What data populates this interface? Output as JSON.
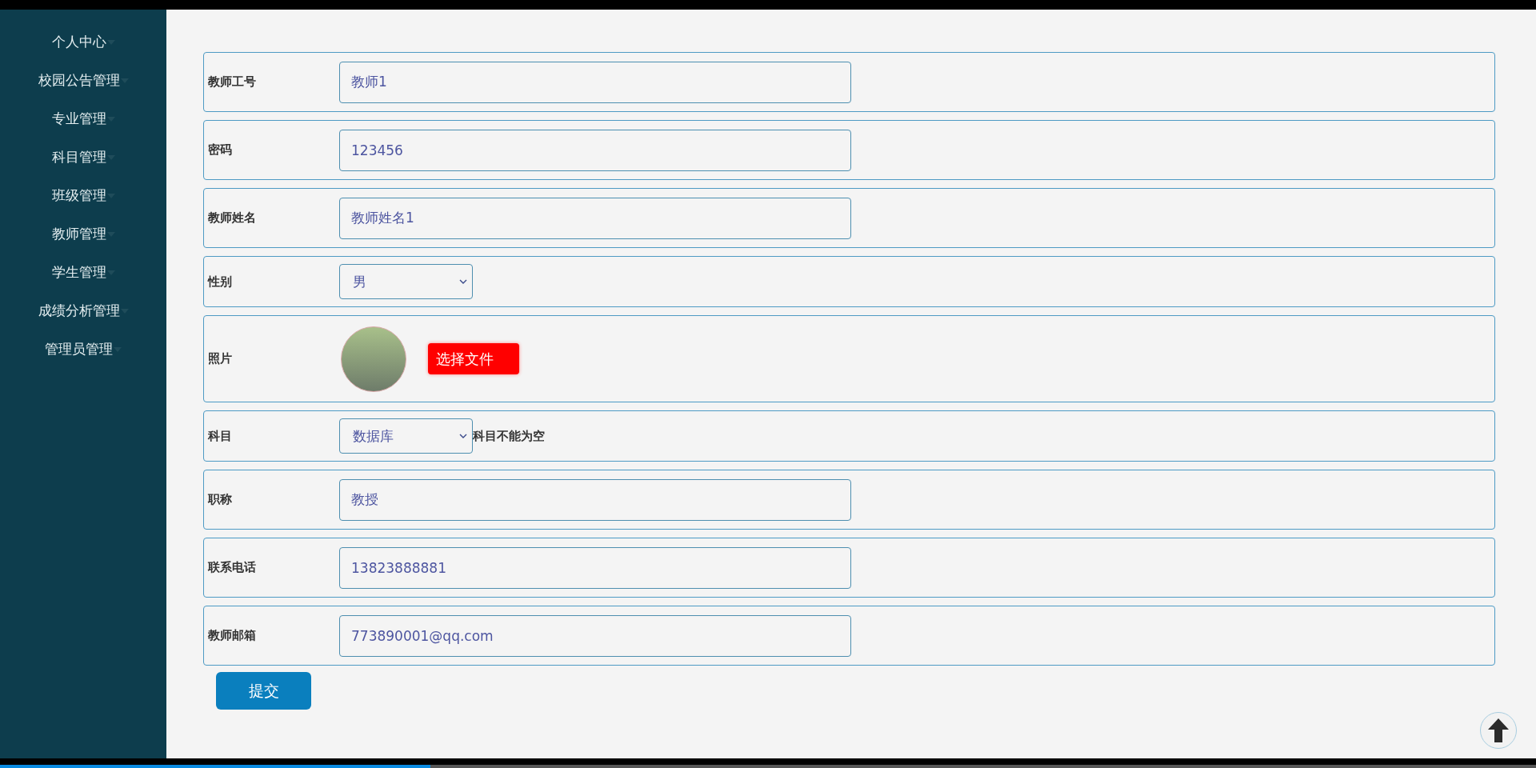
{
  "sidebar": {
    "items": [
      {
        "label": "个人中心"
      },
      {
        "label": "校园公告管理"
      },
      {
        "label": "专业管理"
      },
      {
        "label": "科目管理"
      },
      {
        "label": "班级管理"
      },
      {
        "label": "教师管理"
      },
      {
        "label": "学生管理"
      },
      {
        "label": "成绩分析管理"
      },
      {
        "label": "管理员管理"
      }
    ]
  },
  "form": {
    "fields": [
      {
        "kind": "text",
        "label": "教师工号",
        "value": "教师1"
      },
      {
        "kind": "text",
        "label": "密码",
        "value": "123456"
      },
      {
        "kind": "text",
        "label": "教师姓名",
        "value": "教师姓名1"
      },
      {
        "kind": "select",
        "label": "性别",
        "value": "男"
      },
      {
        "kind": "photo",
        "label": "照片",
        "button": "选择文件"
      },
      {
        "kind": "select",
        "label": "科目",
        "value": "数据库",
        "hint": "科目不能为空"
      },
      {
        "kind": "text",
        "label": "职称",
        "value": "教授"
      },
      {
        "kind": "text",
        "label": "联系电话",
        "value": "13823888881"
      },
      {
        "kind": "text",
        "label": "教师邮箱",
        "value": "773890001@qq.com"
      }
    ],
    "submit": "提交"
  },
  "playback": {
    "level": 0.28
  }
}
